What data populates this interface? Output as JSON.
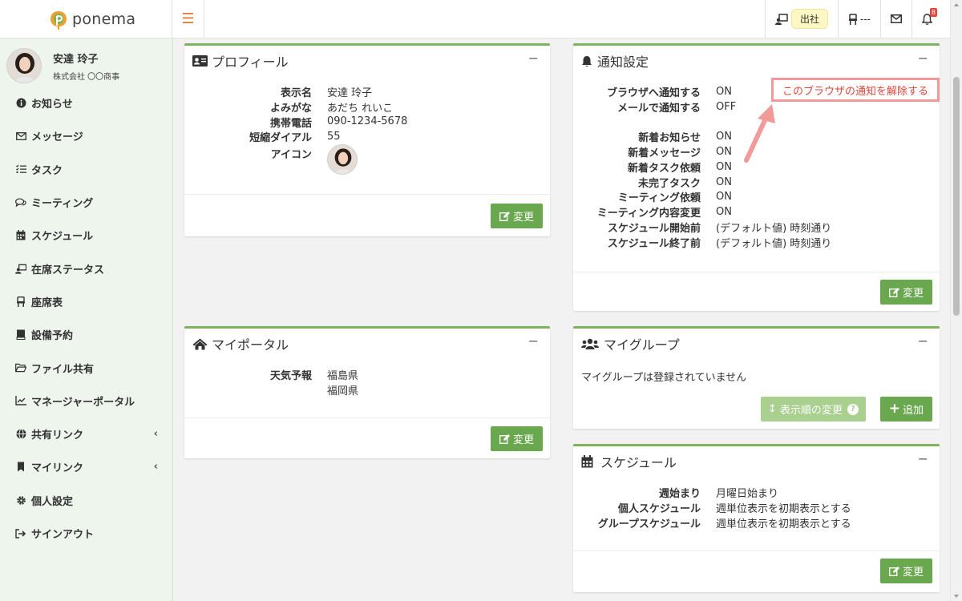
{
  "app": {
    "brand": "ponema"
  },
  "topbar": {
    "attendance_label": "出社",
    "seat_label": "---",
    "notification_count": "8"
  },
  "user": {
    "name": "安達 玲子",
    "company": "株式会社 〇〇商事"
  },
  "sidebar": {
    "items": [
      {
        "label": "お知らせ",
        "icon": "info-circle-icon"
      },
      {
        "label": "メッセージ",
        "icon": "envelope-icon"
      },
      {
        "label": "タスク",
        "icon": "list-check-icon"
      },
      {
        "label": "ミーティング",
        "icon": "comments-icon"
      },
      {
        "label": "スケジュール",
        "icon": "calendar-icon"
      },
      {
        "label": "在席ステータス",
        "icon": "presence-icon"
      },
      {
        "label": "座席表",
        "icon": "chair-icon"
      },
      {
        "label": "設備予約",
        "icon": "book-icon"
      },
      {
        "label": "ファイル共有",
        "icon": "folder-icon"
      },
      {
        "label": "マネージャーポータル",
        "icon": "chart-line-icon"
      },
      {
        "label": "共有リンク",
        "icon": "globe-icon"
      },
      {
        "label": "マイリンク",
        "icon": "bookmark-icon"
      },
      {
        "label": "個人設定",
        "icon": "gear-icon"
      },
      {
        "label": "サインアウト",
        "icon": "sign-out-icon"
      }
    ]
  },
  "profile": {
    "title": "プロフィール",
    "rows": [
      {
        "key": "表示名",
        "value": "安達 玲子"
      },
      {
        "key": "よみがな",
        "value": "あだち れいこ"
      },
      {
        "key": "携帯電話",
        "value": "090-1234-5678"
      },
      {
        "key": "短縮ダイアル",
        "value": "55"
      },
      {
        "key": "アイコン",
        "value": ""
      }
    ],
    "edit_label": "変更"
  },
  "notification": {
    "title": "通知設定",
    "rows": [
      {
        "key": "ブラウザへ通知する",
        "value": "ON"
      },
      {
        "key": "メールで通知する",
        "value": "OFF"
      },
      {
        "key": "",
        "value": ""
      },
      {
        "key": "新着お知らせ",
        "value": "ON"
      },
      {
        "key": "新着メッセージ",
        "value": "ON"
      },
      {
        "key": "新着タスク依頼",
        "value": "ON"
      },
      {
        "key": "未完了タスク",
        "value": "ON"
      },
      {
        "key": "ミーティング依頼",
        "value": "ON"
      },
      {
        "key": "ミーティング内容変更",
        "value": "ON"
      },
      {
        "key": "スケジュール開始前",
        "value": "(デフォルト値) 時刻通り"
      },
      {
        "key": "スケジュール終了前",
        "value": "(デフォルト値) 時刻通り"
      }
    ],
    "disable_browser_link": "このブラウザの通知を解除する",
    "edit_label": "変更"
  },
  "portal": {
    "title": "マイポータル",
    "weather_key": "天気予報",
    "weather_values": [
      "福島県",
      "福岡県"
    ],
    "edit_label": "変更"
  },
  "group": {
    "title": "マイグループ",
    "empty_text": "マイグループは登録されていません",
    "reorder_label": "表示順の変更",
    "add_label": "追加"
  },
  "schedule": {
    "title": "スケジュール",
    "rows": [
      {
        "key": "週始まり",
        "value": "月曜日始まり"
      },
      {
        "key": "個人スケジュール",
        "value": "週単位表示を初期表示とする"
      },
      {
        "key": "グループスケジュール",
        "value": "週単位表示を初期表示とする"
      }
    ],
    "edit_label": "変更"
  },
  "colors": {
    "accent": "#6aa84f",
    "brand_orange": "#e8762b",
    "alert": "#e0463a"
  }
}
